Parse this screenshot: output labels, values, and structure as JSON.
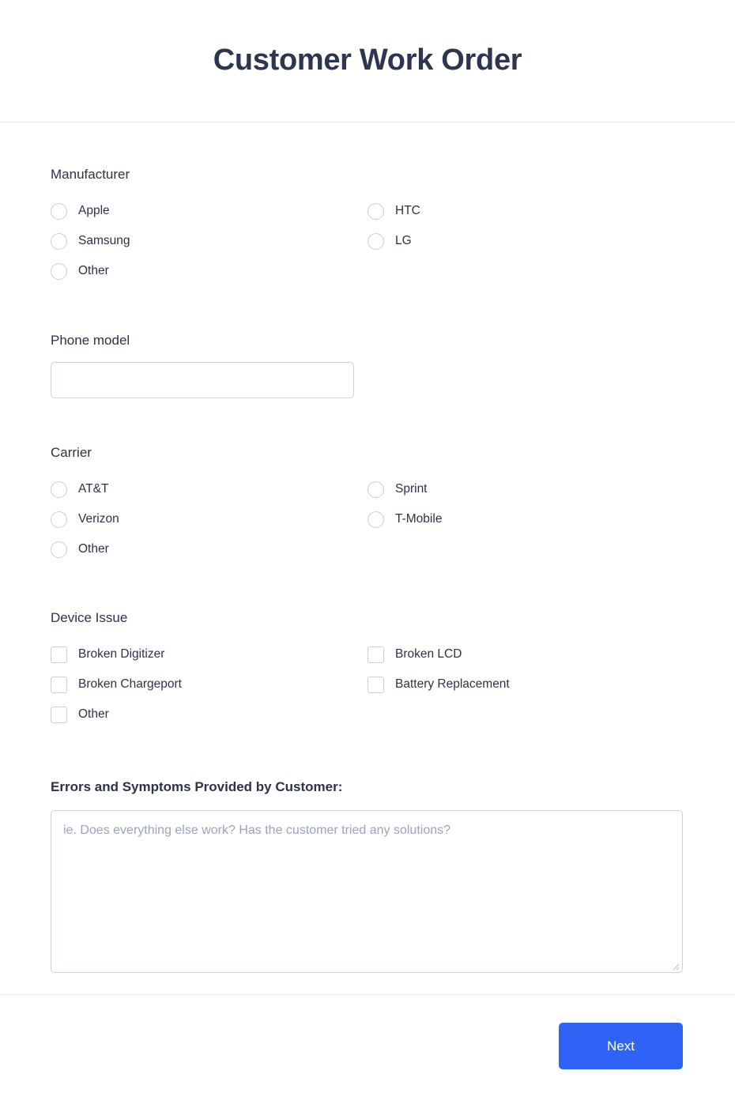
{
  "header": {
    "title": "Customer Work Order"
  },
  "form": {
    "manufacturer": {
      "label": "Manufacturer",
      "type": "radio",
      "options": [
        {
          "label": "Apple"
        },
        {
          "label": "Samsung"
        },
        {
          "label": "Other"
        },
        {
          "label": "HTC"
        },
        {
          "label": "LG"
        }
      ]
    },
    "phone_model": {
      "label": "Phone model",
      "type": "text",
      "value": "",
      "placeholder": ""
    },
    "carrier": {
      "label": "Carrier",
      "type": "radio",
      "options": [
        {
          "label": "AT&T"
        },
        {
          "label": "Verizon"
        },
        {
          "label": "Other"
        },
        {
          "label": "Sprint"
        },
        {
          "label": "T-Mobile"
        }
      ]
    },
    "device_issue": {
      "label": "Device Issue",
      "type": "checkbox",
      "options": [
        {
          "label": "Broken Digitizer"
        },
        {
          "label": "Broken Chargeport"
        },
        {
          "label": "Other"
        },
        {
          "label": "Broken LCD"
        },
        {
          "label": "Battery Replacement"
        }
      ]
    },
    "symptoms": {
      "label": "Errors and Symptoms Provided by Customer:",
      "type": "textarea",
      "value": "",
      "placeholder": "ie. Does everything else work? Has the customer tried any solutions?"
    }
  },
  "footer": {
    "next_label": "Next"
  },
  "icons": {
    "resize_handle": "resize-handle-icon"
  },
  "colors": {
    "title": "#2d3550",
    "text": "#2c3345",
    "placeholder": "#9aa4b4",
    "border": "#ced2d9",
    "control_border": "#c9ced7",
    "divider": "#e6e8ec",
    "accent": "#2f63f5",
    "button_text": "#ffffff",
    "background": "#ffffff"
  }
}
